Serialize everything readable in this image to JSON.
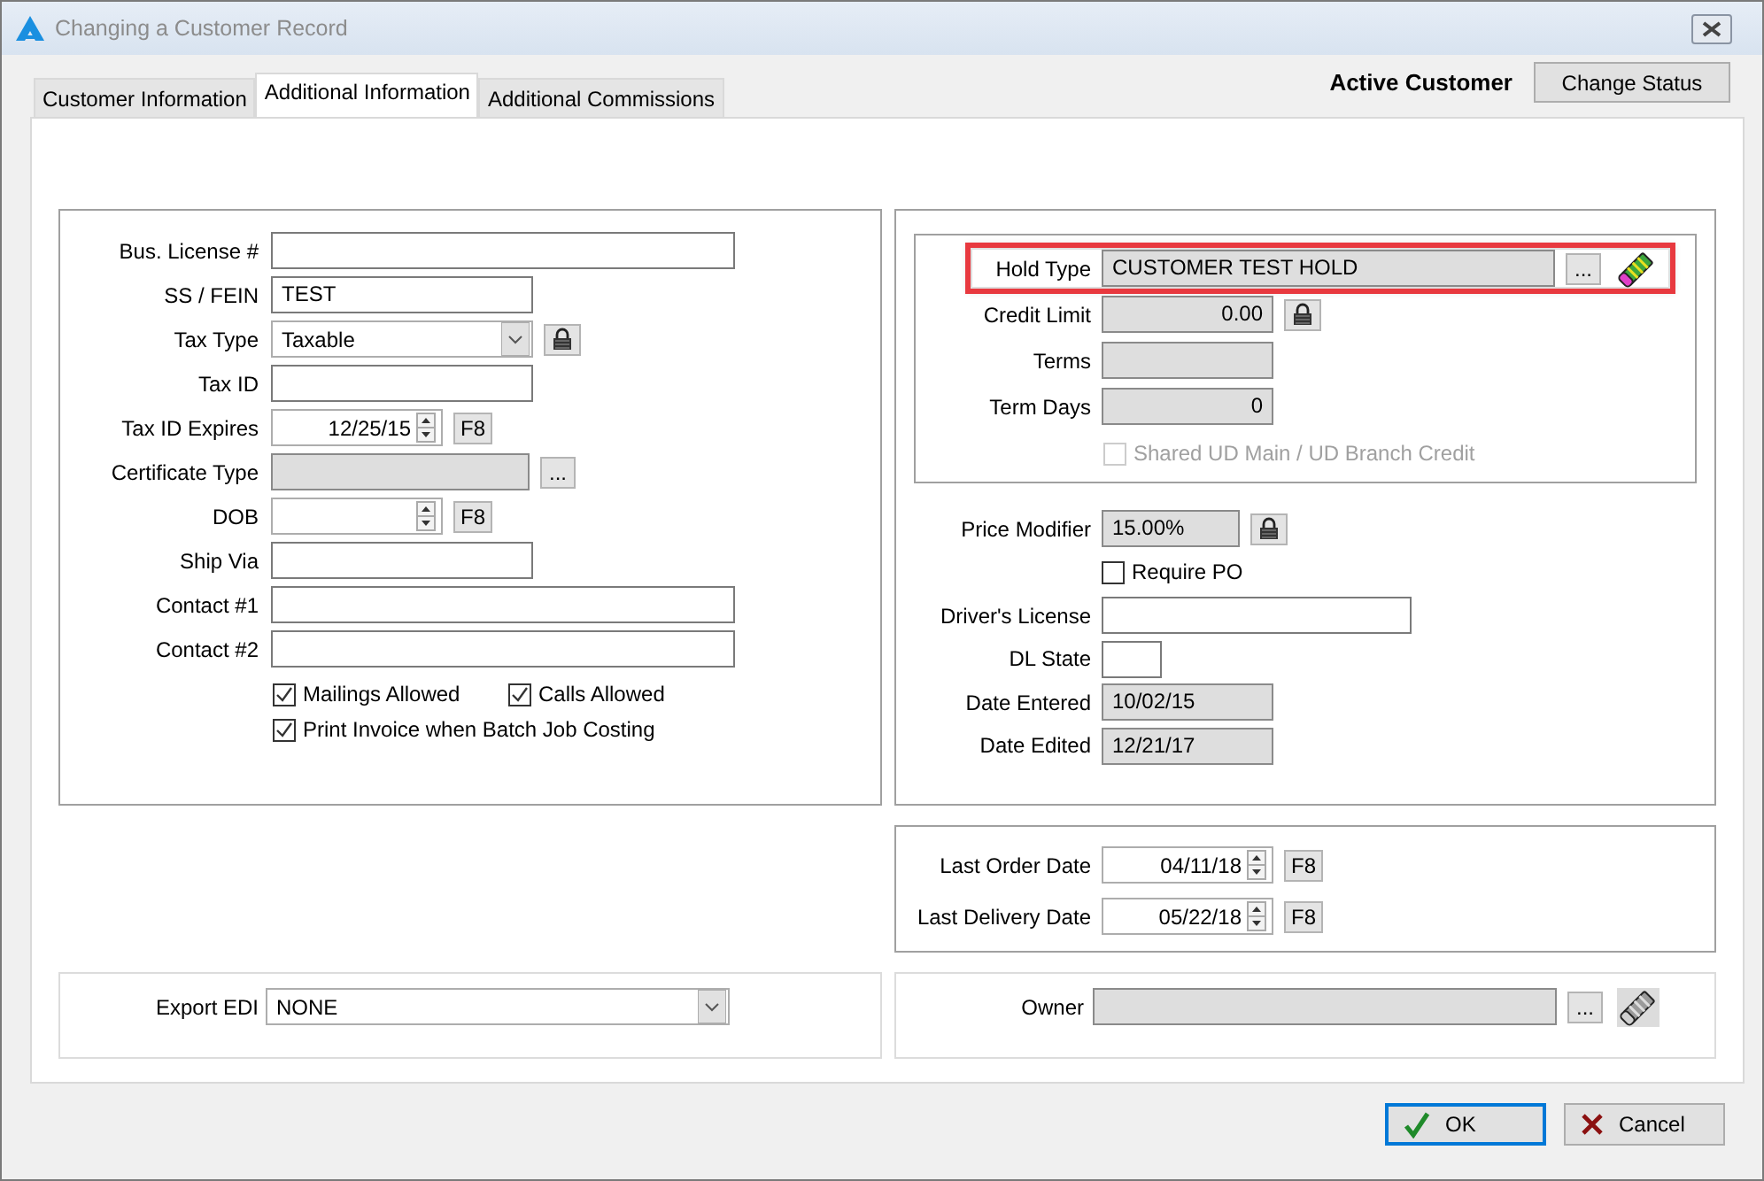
{
  "window": {
    "title": "Changing a Customer Record"
  },
  "tabs": [
    {
      "label": "Customer Information",
      "selected": false
    },
    {
      "label": "Additional Information",
      "selected": true
    },
    {
      "label": "Additional Commissions",
      "selected": false
    }
  ],
  "status": {
    "label": "Active Customer",
    "button": "Change Status"
  },
  "general_fields": [
    {
      "label": "Bus. License #",
      "kind": "text"
    },
    {
      "label": "SS / FEIN",
      "kind": "text",
      "value": "TEST"
    },
    {
      "label": "Tax Type",
      "kind": "combo",
      "value": "Taxable",
      "lock": true
    },
    {
      "label": "Tax ID",
      "kind": "text"
    },
    {
      "label": "Tax ID Expires",
      "kind": "spin",
      "value": "12/25/15",
      "button": "F8"
    },
    {
      "label": "Certificate Type",
      "kind": "readonly",
      "button": "..."
    },
    {
      "label": "DOB",
      "kind": "spin",
      "button": "F8"
    },
    {
      "label": "Ship Via",
      "kind": "text"
    },
    {
      "label": "Contact #1",
      "kind": "text"
    },
    {
      "label": "Contact #2",
      "kind": "text"
    }
  ],
  "general_checkboxes": [
    {
      "label": "Mailings Allowed",
      "checked": true
    },
    {
      "label": "Calls Allowed",
      "checked": true
    },
    {
      "label": "Print Invoice when Batch Job Costing",
      "checked": true
    }
  ],
  "credit_fields": [
    {
      "label": "Hold Type",
      "kind": "readonly",
      "value": "CUSTOMER TEST HOLD",
      "button": "...",
      "eraser": {
        "disabled": false
      },
      "highlighted": true
    },
    {
      "label": "Credit Limit",
      "kind": "number",
      "value": "0.00",
      "lock": true,
      "highlighted": false
    },
    {
      "label": "Terms",
      "kind": "readonly",
      "highlighted": false
    },
    {
      "label": "Term Days",
      "kind": "number",
      "value": "0",
      "highlighted": false
    }
  ],
  "shared_credit": {
    "label": "Shared UD Main / UD Branch Credit",
    "checked": false,
    "disabled": true
  },
  "pricing_fields": [
    {
      "label": "Price Modifier",
      "kind": "readonly",
      "value": "15.00%",
      "lock": true
    },
    {
      "label": "Require PO",
      "kind": "checkbox",
      "checked": false
    },
    {
      "label": "Driver's License",
      "kind": "text"
    },
    {
      "label": "DL State",
      "kind": "text"
    },
    {
      "label": "Date Entered",
      "kind": "readonly",
      "value": "10/02/15"
    },
    {
      "label": "Date Edited",
      "kind": "readonly",
      "value": "12/21/17"
    }
  ],
  "order_dates": [
    {
      "label": "Last Order Date",
      "kind": "spin",
      "value": "04/11/18",
      "button": "F8"
    },
    {
      "label": "Last Delivery Date",
      "kind": "spin",
      "value": "05/22/18",
      "button": "F8"
    }
  ],
  "export_edi": {
    "label": "Export EDI",
    "kind": "combo",
    "value": "NONE"
  },
  "owner": {
    "label": "Owner",
    "kind": "readonly",
    "button": "...",
    "eraser": {
      "disabled": true
    }
  },
  "buttons": [
    {
      "label": "OK",
      "kind": "ok",
      "default": true
    },
    {
      "label": "Cancel",
      "kind": "cancel",
      "default": false
    }
  ]
}
